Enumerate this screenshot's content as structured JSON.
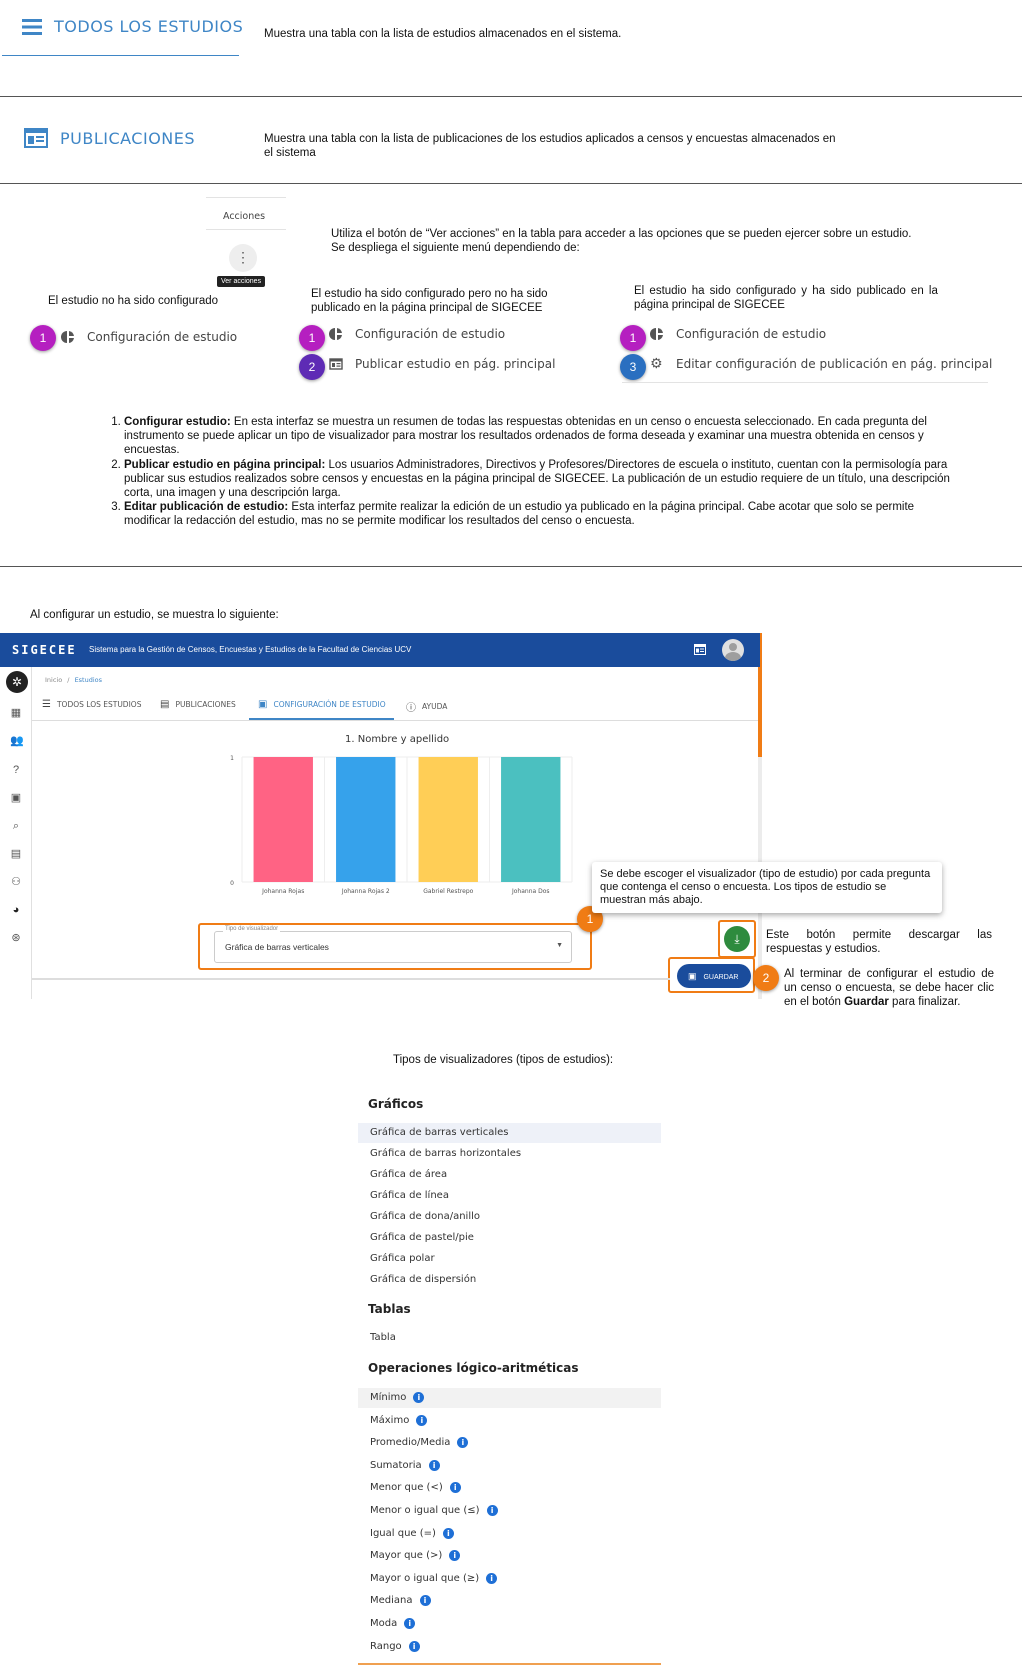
{
  "todos": {
    "title": "TODOS LOS ESTUDIOS",
    "description": "Muestra una tabla con la lista de estudios almacenados en el sistema."
  },
  "publicaciones": {
    "title": "PUBLICACIONES",
    "description_1": "Muestra una tabla con la lista de publicaciones de los estudios aplicados a censos y encuestas almacenados en",
    "description_2": "el sistema"
  },
  "acciones": {
    "column_header": "Acciones",
    "tooltip": "Ver acciones",
    "intro_1": "Utiliza el botón de “Ver acciones” en la tabla para acceder a las opciones que se pueden ejercer sobre un estudio.",
    "intro_2": "Se despliega el siguiente menú dependiendo de:"
  },
  "cases": {
    "case1": {
      "title": "El estudio no ha sido configurado",
      "items": [
        {
          "num": "1",
          "label": "Configuración de estudio"
        }
      ]
    },
    "case2": {
      "title_1": "El estudio ha sido configurado pero no ha sido",
      "title_2": "publicado en la página principal de SIGECEE",
      "items": [
        {
          "num": "1",
          "label": "Configuración de estudio"
        },
        {
          "num": "2",
          "label": "Publicar estudio en pág. principal"
        }
      ]
    },
    "case3": {
      "title_1": "El estudio ha sido configurado y ha sido publicado en la",
      "title_2": "página principal de SIGECEE",
      "items": [
        {
          "num": "1",
          "label": "Configuración de estudio"
        },
        {
          "num": "3",
          "label": "Editar configuración de publicación en pág. principal"
        }
      ]
    }
  },
  "explanations": [
    {
      "term": "Configurar estudio:",
      "text": " En esta interfaz se muestra un resumen de todas las respuestas obtenidas en un censo o encuesta seleccionado. En cada pregunta del instrumento se puede aplicar un tipo de visualizador para mostrar los resultados ordenados de forma deseada y examinar una muestra obtenida en censos y encuestas."
    },
    {
      "term": "Publicar estudio en página principal:",
      "text": " Los usuarios Administradores, Directivos y Profesores/Directores de escuela o instituto, cuentan con la permisología para publicar sus estudios realizados sobre censos y encuestas en la página principal de SIGECEE. La publicación de un estudio requiere de un título, una descripción corta, una imagen y una descripción larga."
    },
    {
      "term": "Editar publicación de estudio:",
      "text": " Esta interfaz permite realizar la edición de un estudio ya publicado en la página principal. Cabe acotar que solo se permite modificar la redacción del estudio, mas no se permite modificar los resultados del censo o encuesta."
    }
  ],
  "config_intro": "Al configurar un estudio, se muestra lo siguiente:",
  "app": {
    "brand": "SIGECEE",
    "subtitle": "Sistema para la Gestión de Censos, Encuestas y Estudios de la Facultad de Ciencias UCV",
    "breadcrumb_home": "Inicio",
    "breadcrumb_sep": "/",
    "breadcrumb_current": "Estudios",
    "tabs": [
      "TODOS LOS ESTUDIOS",
      "PUBLICACIONES",
      "CONFIGURACIÓN DE ESTUDIO",
      "AYUDA"
    ],
    "select_label": "Tipo de visualizador",
    "select_value": "Gráfica de barras verticales",
    "save_label": "GUARDAR",
    "accent": "#1a4c9c"
  },
  "chart_data": {
    "type": "bar",
    "title": "1. Nombre y apellido",
    "categories": [
      "Johanna Rojas",
      "Johanna Rojas 2",
      "Gabriel Restrepo",
      "Johanna Dos"
    ],
    "values": [
      1,
      1,
      1,
      1
    ],
    "colors": [
      "#ff6384",
      "#36a2eb",
      "#ffce56",
      "#4bc0c0"
    ],
    "ylim": [
      0,
      1
    ],
    "yticks": [
      "0",
      "1"
    ]
  },
  "callouts": {
    "visualizer_note": "Se debe escoger el visualizador (tipo de estudio) por cada pregunta que contenga el censo o encuesta. Los tipos de estudio se muestran más abajo.",
    "download_note": "Este botón permite descargar las respuestas y estudios.",
    "save_note_1": "Al terminar de configurar el estudio de un censo o encuesta, se debe hacer clic en el botón ",
    "save_note_bold": "Guardar",
    "save_note_2": " para finalizar.",
    "num1": "1",
    "num2": "2"
  },
  "visualizers": {
    "heading": "Tipos de visualizadores (tipos de estudios):",
    "graficos_title": "Gráficos",
    "graficos": [
      "Gráfica de barras verticales",
      "Gráfica de barras horizontales",
      "Gráfica de área",
      "Gráfica de línea",
      "Gráfica de dona/anillo",
      "Gráfica de pastel/pie",
      "Gráfica polar",
      "Gráfica de dispersión"
    ],
    "tablas_title": "Tablas",
    "tablas": [
      "Tabla"
    ],
    "operaciones_title": "Operaciones lógico-aritméticas",
    "operaciones": [
      "Mínimo",
      "Máximo",
      "Promedio/Media",
      "Sumatoria",
      "Menor que (<)",
      "Menor o igual que (≤)",
      "Igual que (=)",
      "Mayor que (>)",
      "Mayor o igual que (≥)",
      "Mediana",
      "Moda",
      "Rango"
    ]
  }
}
